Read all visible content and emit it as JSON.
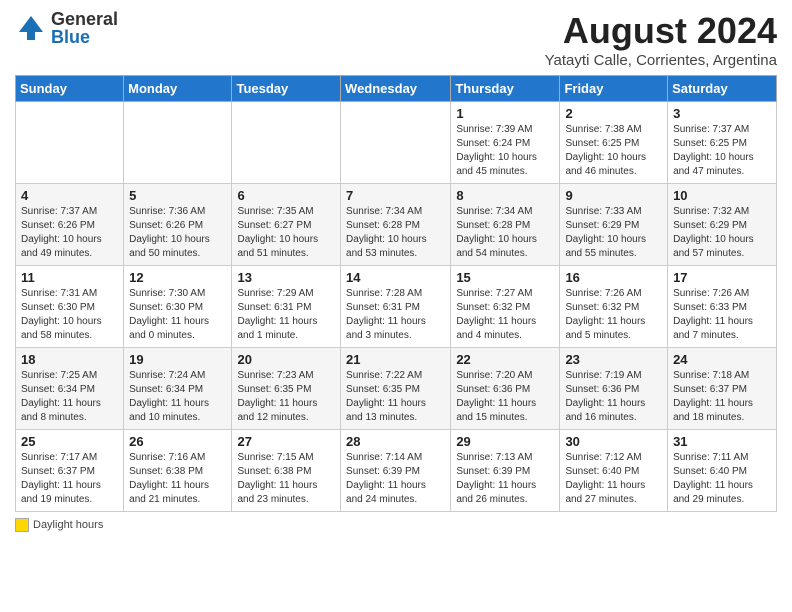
{
  "logo": {
    "general": "General",
    "blue": "Blue"
  },
  "title": "August 2024",
  "subtitle": "Yatayti Calle, Corrientes, Argentina",
  "days_of_week": [
    "Sunday",
    "Monday",
    "Tuesday",
    "Wednesday",
    "Thursday",
    "Friday",
    "Saturday"
  ],
  "weeks": [
    [
      {
        "day": "",
        "info": ""
      },
      {
        "day": "",
        "info": ""
      },
      {
        "day": "",
        "info": ""
      },
      {
        "day": "",
        "info": ""
      },
      {
        "day": "1",
        "info": "Sunrise: 7:39 AM\nSunset: 6:24 PM\nDaylight: 10 hours\nand 45 minutes."
      },
      {
        "day": "2",
        "info": "Sunrise: 7:38 AM\nSunset: 6:25 PM\nDaylight: 10 hours\nand 46 minutes."
      },
      {
        "day": "3",
        "info": "Sunrise: 7:37 AM\nSunset: 6:25 PM\nDaylight: 10 hours\nand 47 minutes."
      }
    ],
    [
      {
        "day": "4",
        "info": "Sunrise: 7:37 AM\nSunset: 6:26 PM\nDaylight: 10 hours\nand 49 minutes."
      },
      {
        "day": "5",
        "info": "Sunrise: 7:36 AM\nSunset: 6:26 PM\nDaylight: 10 hours\nand 50 minutes."
      },
      {
        "day": "6",
        "info": "Sunrise: 7:35 AM\nSunset: 6:27 PM\nDaylight: 10 hours\nand 51 minutes."
      },
      {
        "day": "7",
        "info": "Sunrise: 7:34 AM\nSunset: 6:28 PM\nDaylight: 10 hours\nand 53 minutes."
      },
      {
        "day": "8",
        "info": "Sunrise: 7:34 AM\nSunset: 6:28 PM\nDaylight: 10 hours\nand 54 minutes."
      },
      {
        "day": "9",
        "info": "Sunrise: 7:33 AM\nSunset: 6:29 PM\nDaylight: 10 hours\nand 55 minutes."
      },
      {
        "day": "10",
        "info": "Sunrise: 7:32 AM\nSunset: 6:29 PM\nDaylight: 10 hours\nand 57 minutes."
      }
    ],
    [
      {
        "day": "11",
        "info": "Sunrise: 7:31 AM\nSunset: 6:30 PM\nDaylight: 10 hours\nand 58 minutes."
      },
      {
        "day": "12",
        "info": "Sunrise: 7:30 AM\nSunset: 6:30 PM\nDaylight: 11 hours\nand 0 minutes."
      },
      {
        "day": "13",
        "info": "Sunrise: 7:29 AM\nSunset: 6:31 PM\nDaylight: 11 hours\nand 1 minute."
      },
      {
        "day": "14",
        "info": "Sunrise: 7:28 AM\nSunset: 6:31 PM\nDaylight: 11 hours\nand 3 minutes."
      },
      {
        "day": "15",
        "info": "Sunrise: 7:27 AM\nSunset: 6:32 PM\nDaylight: 11 hours\nand 4 minutes."
      },
      {
        "day": "16",
        "info": "Sunrise: 7:26 AM\nSunset: 6:32 PM\nDaylight: 11 hours\nand 5 minutes."
      },
      {
        "day": "17",
        "info": "Sunrise: 7:26 AM\nSunset: 6:33 PM\nDaylight: 11 hours\nand 7 minutes."
      }
    ],
    [
      {
        "day": "18",
        "info": "Sunrise: 7:25 AM\nSunset: 6:34 PM\nDaylight: 11 hours\nand 8 minutes."
      },
      {
        "day": "19",
        "info": "Sunrise: 7:24 AM\nSunset: 6:34 PM\nDaylight: 11 hours\nand 10 minutes."
      },
      {
        "day": "20",
        "info": "Sunrise: 7:23 AM\nSunset: 6:35 PM\nDaylight: 11 hours\nand 12 minutes."
      },
      {
        "day": "21",
        "info": "Sunrise: 7:22 AM\nSunset: 6:35 PM\nDaylight: 11 hours\nand 13 minutes."
      },
      {
        "day": "22",
        "info": "Sunrise: 7:20 AM\nSunset: 6:36 PM\nDaylight: 11 hours\nand 15 minutes."
      },
      {
        "day": "23",
        "info": "Sunrise: 7:19 AM\nSunset: 6:36 PM\nDaylight: 11 hours\nand 16 minutes."
      },
      {
        "day": "24",
        "info": "Sunrise: 7:18 AM\nSunset: 6:37 PM\nDaylight: 11 hours\nand 18 minutes."
      }
    ],
    [
      {
        "day": "25",
        "info": "Sunrise: 7:17 AM\nSunset: 6:37 PM\nDaylight: 11 hours\nand 19 minutes."
      },
      {
        "day": "26",
        "info": "Sunrise: 7:16 AM\nSunset: 6:38 PM\nDaylight: 11 hours\nand 21 minutes."
      },
      {
        "day": "27",
        "info": "Sunrise: 7:15 AM\nSunset: 6:38 PM\nDaylight: 11 hours\nand 23 minutes."
      },
      {
        "day": "28",
        "info": "Sunrise: 7:14 AM\nSunset: 6:39 PM\nDaylight: 11 hours\nand 24 minutes."
      },
      {
        "day": "29",
        "info": "Sunrise: 7:13 AM\nSunset: 6:39 PM\nDaylight: 11 hours\nand 26 minutes."
      },
      {
        "day": "30",
        "info": "Sunrise: 7:12 AM\nSunset: 6:40 PM\nDaylight: 11 hours\nand 27 minutes."
      },
      {
        "day": "31",
        "info": "Sunrise: 7:11 AM\nSunset: 6:40 PM\nDaylight: 11 hours\nand 29 minutes."
      }
    ]
  ],
  "legend": {
    "daylight_label": "Daylight hours"
  }
}
